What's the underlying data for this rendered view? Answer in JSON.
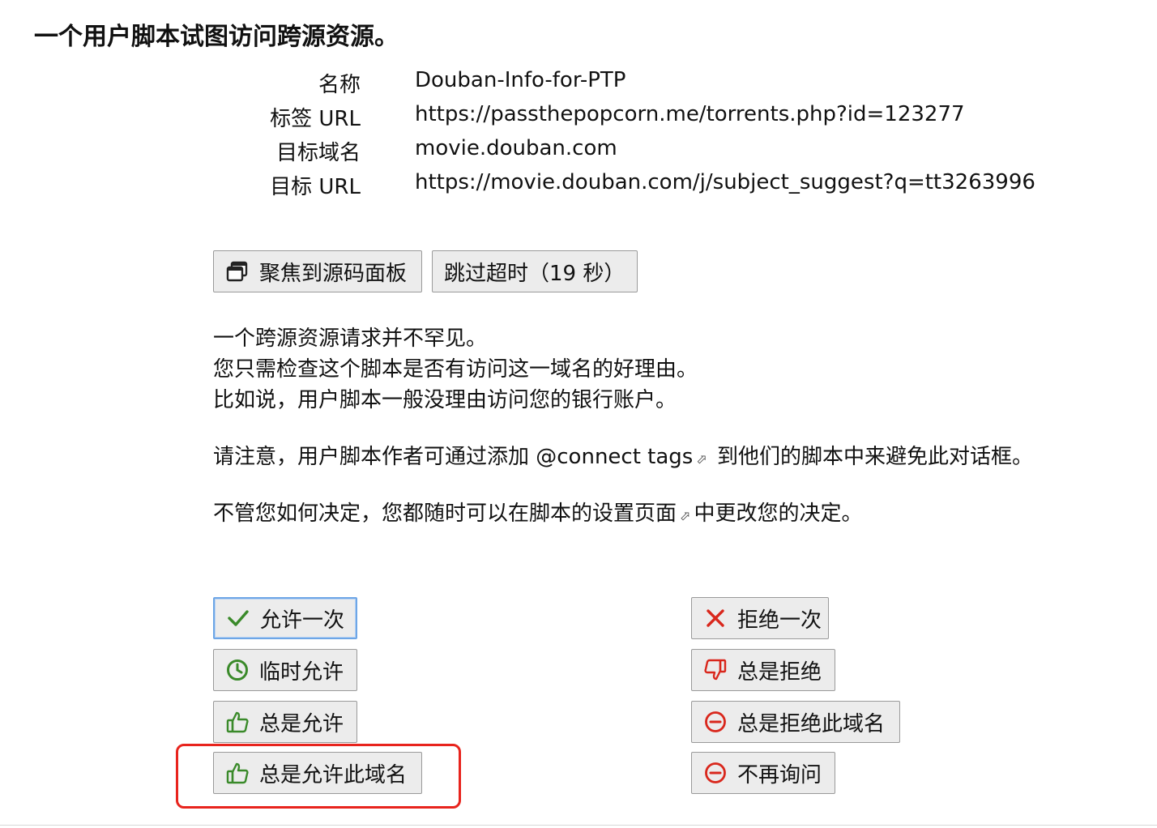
{
  "title": "一个用户脚本试图访问跨源资源。",
  "info": [
    {
      "key": "名称",
      "value": "Douban-Info-for-PTP"
    },
    {
      "key": "标签 URL",
      "value": "https://passthepopcorn.me/torrents.php?id=123277"
    },
    {
      "key": "目标域名",
      "value": "movie.douban.com"
    },
    {
      "key": "目标 URL",
      "value": "https://movie.douban.com/j/subject_suggest?q=tt3263996"
    }
  ],
  "actions": {
    "focus_label": "聚焦到源码面板",
    "skip_label": "跳过超时（19 秒）"
  },
  "explanation": {
    "line1": "一个跨源资源请求并不罕见。",
    "line2": "您只需检查这个脚本是否有访问这一域名的好理由。",
    "line3": "比如说，用户脚本一般没理由访问您的银行账户。",
    "note_prefix": "请注意，用户脚本作者可通过添加 ",
    "note_link": "@connect tags",
    "note_suffix": " 到他们的脚本中来避免此对话框。",
    "settings_prefix": "不管您如何决定，您都随时可以在脚本的",
    "settings_link": "设置页面",
    "settings_suffix": "中更改您的决定。",
    "ext_icon": "⬀"
  },
  "allow_buttons": {
    "once": "允许一次",
    "temporary": "临时允许",
    "always": "总是允许",
    "always_domain": "总是允许此域名"
  },
  "deny_buttons": {
    "once": "拒绝一次",
    "always": "总是拒绝",
    "always_domain": "总是拒绝此域名",
    "never_ask": "不再询问"
  },
  "colors": {
    "allow_icon": "#3a8a2a",
    "deny_icon": "#d9271c",
    "highlight": "#e8241d",
    "primary_border": "#6ea6e6"
  },
  "icons": {
    "focus": "window-stack-icon",
    "allow_once": "checkmark-icon",
    "allow_temp": "clock-icon",
    "allow_always": "thumbs-up-icon",
    "deny_once": "x-icon",
    "deny_always": "thumbs-down-icon",
    "deny_domain": "minus-circle-icon",
    "never_ask": "minus-circle-icon"
  }
}
